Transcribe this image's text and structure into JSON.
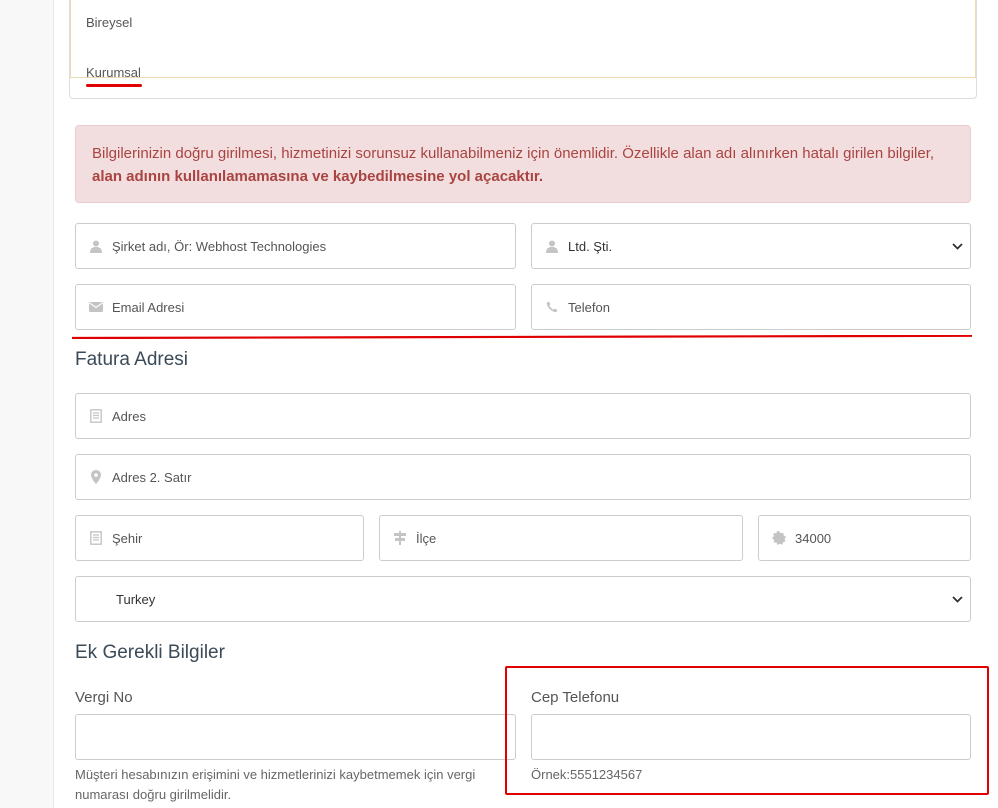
{
  "tabs": {
    "individual": "Bireysel",
    "corporate": "Kurumsal"
  },
  "alert": {
    "text": "Bilgilerinizin doğru girilmesi, hizmetinizi sorunsuz kullanabilmeniz için önemlidir. Özellikle alan adı alınırken hatalı girilen bilgiler, ",
    "bold": "alan adının kullanılamamasına ve kaybedilmesine yol açacaktır."
  },
  "company": {
    "name_placeholder": "Şirket adı, Ör: Webhost Technologies",
    "type_value": "Ltd. Şti.",
    "email_placeholder": "Email Adresi",
    "phone_placeholder": "Telefon"
  },
  "billing": {
    "title": "Fatura Adresi",
    "address_placeholder": "Adres",
    "address2_placeholder": "Adres 2. Satır",
    "city_placeholder": "Şehir",
    "district_placeholder": "İlçe",
    "postcode_placeholder": "34000",
    "country_value": "Turkey"
  },
  "extra": {
    "title": "Ek Gerekli Bilgiler",
    "tax_label": "Vergi No",
    "tax_help": "Müşteri hesabınızın erişimini ve hizmetlerinizi kaybetmemek için vergi numarası doğru girilmelidir.",
    "mobile_label": "Cep Telefonu",
    "mobile_help": "Örnek:5551234567"
  },
  "colors": {
    "accent_red": "#e00000",
    "alert_bg": "#f2dede",
    "alert_text": "#a94442"
  }
}
